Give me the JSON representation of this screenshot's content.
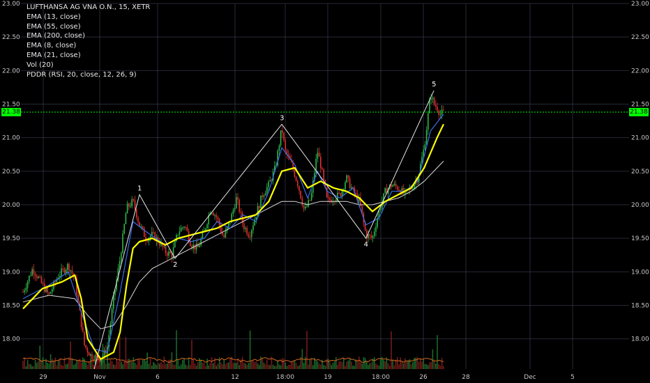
{
  "legend": {
    "symbol": "LUFTHANSA AG VNA O.N., 15, XETR",
    "indicators": [
      "EMA (13, close)",
      "EMA (55, close)",
      "EMA (200, close)",
      "EMA (8, close)",
      "EMA (21, close)",
      "Vol (20)",
      "PDDR (RSI, 20, close, 12, 26, 9)"
    ]
  },
  "last_price": "21.38",
  "colors": {
    "background": "#000000",
    "grid": "#4a4a66",
    "up_candle": "#2eb84a",
    "down_candle": "#e03030",
    "ema_fast_blue": "#3a6ee8",
    "ema_yellow": "#ffff00",
    "ema_200": "#d9d9d9",
    "wave_lines": "#e6e6e6",
    "last_price_line": "#00ff00",
    "volume_up": "#1e7a30",
    "volume_down": "#8a1e1e",
    "rsi_line": "#d2691e"
  },
  "chart_data": {
    "type": "line",
    "title": "LUFTHANSA AG VNA O.N., 15, XETR",
    "x_axis_ticks": [
      "29",
      "Nov",
      "6",
      "12",
      "18:00",
      "19",
      "18:00",
      "26",
      "28",
      "Dec",
      "5"
    ],
    "y_axis_ticks": [
      "23.00",
      "22.50",
      "22.00",
      "21.50",
      "21.00",
      "20.50",
      "20.00",
      "19.50",
      "19.00",
      "18.50",
      "18.00"
    ],
    "y_range": [
      17.55,
      23.0
    ],
    "grid": true,
    "price_series": [
      [
        0,
        18.7
      ],
      [
        3,
        19.05
      ],
      [
        6,
        18.8
      ],
      [
        8,
        18.65
      ],
      [
        11,
        18.95
      ],
      [
        14,
        19.1
      ],
      [
        16,
        18.9
      ],
      [
        19,
        17.9
      ],
      [
        21,
        17.75
      ],
      [
        24,
        17.7
      ],
      [
        26,
        17.85
      ],
      [
        28,
        18.6
      ],
      [
        30,
        19.2
      ],
      [
        32,
        19.95
      ],
      [
        34,
        20.05
      ],
      [
        36,
        19.7
      ],
      [
        38,
        19.5
      ],
      [
        40,
        19.55
      ],
      [
        42,
        19.45
      ],
      [
        44,
        19.3
      ],
      [
        46,
        19.25
      ],
      [
        48,
        19.6
      ],
      [
        50,
        19.7
      ],
      [
        52,
        19.4
      ],
      [
        54,
        19.35
      ],
      [
        56,
        19.6
      ],
      [
        58,
        19.95
      ],
      [
        60,
        19.8
      ],
      [
        62,
        19.5
      ],
      [
        64,
        19.75
      ],
      [
        66,
        20.1
      ],
      [
        68,
        19.7
      ],
      [
        70,
        19.55
      ],
      [
        72,
        19.85
      ],
      [
        74,
        20.15
      ],
      [
        76,
        20.3
      ],
      [
        78,
        20.55
      ],
      [
        80,
        21.15
      ],
      [
        81,
        20.8
      ],
      [
        83,
        20.6
      ],
      [
        85,
        20.3
      ],
      [
        87,
        19.9
      ],
      [
        89,
        20.1
      ],
      [
        91,
        20.8
      ],
      [
        92,
        20.6
      ],
      [
        94,
        20.05
      ],
      [
        96,
        20.1
      ],
      [
        98,
        20.15
      ],
      [
        100,
        20.4
      ],
      [
        102,
        20.2
      ],
      [
        104,
        20.05
      ],
      [
        106,
        19.55
      ],
      [
        108,
        19.5
      ],
      [
        110,
        19.9
      ],
      [
        112,
        20.2
      ],
      [
        114,
        20.3
      ],
      [
        116,
        20.25
      ],
      [
        118,
        20.15
      ],
      [
        120,
        20.25
      ],
      [
        122,
        20.4
      ],
      [
        124,
        20.85
      ],
      [
        126,
        21.65
      ],
      [
        127,
        21.5
      ],
      [
        128,
        21.45
      ],
      [
        129,
        21.35
      ],
      [
        130,
        21.38
      ]
    ],
    "ema_short_series": [
      [
        0,
        18.6
      ],
      [
        8,
        18.8
      ],
      [
        14,
        19.0
      ],
      [
        18,
        18.4
      ],
      [
        22,
        17.85
      ],
      [
        26,
        17.8
      ],
      [
        30,
        18.7
      ],
      [
        34,
        19.75
      ],
      [
        38,
        19.6
      ],
      [
        44,
        19.4
      ],
      [
        48,
        19.5
      ],
      [
        52,
        19.45
      ],
      [
        56,
        19.5
      ],
      [
        60,
        19.75
      ],
      [
        64,
        19.65
      ],
      [
        68,
        19.85
      ],
      [
        72,
        19.75
      ],
      [
        76,
        20.2
      ],
      [
        80,
        20.85
      ],
      [
        84,
        20.6
      ],
      [
        88,
        20.1
      ],
      [
        91,
        20.5
      ],
      [
        94,
        20.2
      ],
      [
        98,
        20.1
      ],
      [
        102,
        20.25
      ],
      [
        106,
        19.7
      ],
      [
        110,
        19.8
      ],
      [
        114,
        20.2
      ],
      [
        118,
        20.2
      ],
      [
        122,
        20.35
      ],
      [
        126,
        21.1
      ],
      [
        130,
        21.35
      ]
    ],
    "ema_yellow_series": [
      [
        0,
        18.45
      ],
      [
        6,
        18.75
      ],
      [
        12,
        18.85
      ],
      [
        16,
        18.95
      ],
      [
        18,
        18.6
      ],
      [
        20,
        18.0
      ],
      [
        24,
        17.7
      ],
      [
        28,
        17.8
      ],
      [
        30,
        18.1
      ],
      [
        32,
        18.8
      ],
      [
        34,
        19.35
      ],
      [
        36,
        19.45
      ],
      [
        40,
        19.5
      ],
      [
        44,
        19.4
      ],
      [
        48,
        19.5
      ],
      [
        52,
        19.55
      ],
      [
        56,
        19.6
      ],
      [
        60,
        19.65
      ],
      [
        64,
        19.75
      ],
      [
        68,
        19.8
      ],
      [
        72,
        19.85
      ],
      [
        76,
        20.05
      ],
      [
        80,
        20.5
      ],
      [
        84,
        20.55
      ],
      [
        88,
        20.25
      ],
      [
        92,
        20.35
      ],
      [
        96,
        20.25
      ],
      [
        100,
        20.2
      ],
      [
        104,
        20.1
      ],
      [
        108,
        19.9
      ],
      [
        112,
        20.05
      ],
      [
        116,
        20.15
      ],
      [
        120,
        20.25
      ],
      [
        124,
        20.55
      ],
      [
        128,
        21.0
      ],
      [
        130,
        21.2
      ]
    ],
    "ema_200_series": [
      [
        0,
        18.55
      ],
      [
        8,
        18.65
      ],
      [
        16,
        18.6
      ],
      [
        20,
        18.35
      ],
      [
        24,
        18.15
      ],
      [
        28,
        18.2
      ],
      [
        32,
        18.5
      ],
      [
        36,
        18.85
      ],
      [
        40,
        19.05
      ],
      [
        44,
        19.15
      ],
      [
        48,
        19.25
      ],
      [
        52,
        19.35
      ],
      [
        56,
        19.45
      ],
      [
        60,
        19.55
      ],
      [
        64,
        19.65
      ],
      [
        68,
        19.75
      ],
      [
        72,
        19.85
      ],
      [
        76,
        19.95
      ],
      [
        80,
        20.05
      ],
      [
        84,
        20.05
      ],
      [
        88,
        20.0
      ],
      [
        92,
        20.05
      ],
      [
        96,
        20.05
      ],
      [
        100,
        20.05
      ],
      [
        104,
        20.0
      ],
      [
        108,
        20.0
      ],
      [
        112,
        20.05
      ],
      [
        116,
        20.1
      ],
      [
        120,
        20.2
      ],
      [
        124,
        20.35
      ],
      [
        128,
        20.55
      ],
      [
        130,
        20.65
      ]
    ],
    "wave_points": [
      {
        "label": "",
        "x": 22,
        "y": 17.55
      },
      {
        "label": "1",
        "x": 36,
        "y": 20.15
      },
      {
        "label": "2",
        "x": 47,
        "y": 19.2
      },
      {
        "label": "3",
        "x": 80,
        "y": 21.2
      },
      {
        "label": "4",
        "x": 106,
        "y": 19.5
      },
      {
        "label": "5",
        "x": 127,
        "y": 21.7
      }
    ]
  }
}
